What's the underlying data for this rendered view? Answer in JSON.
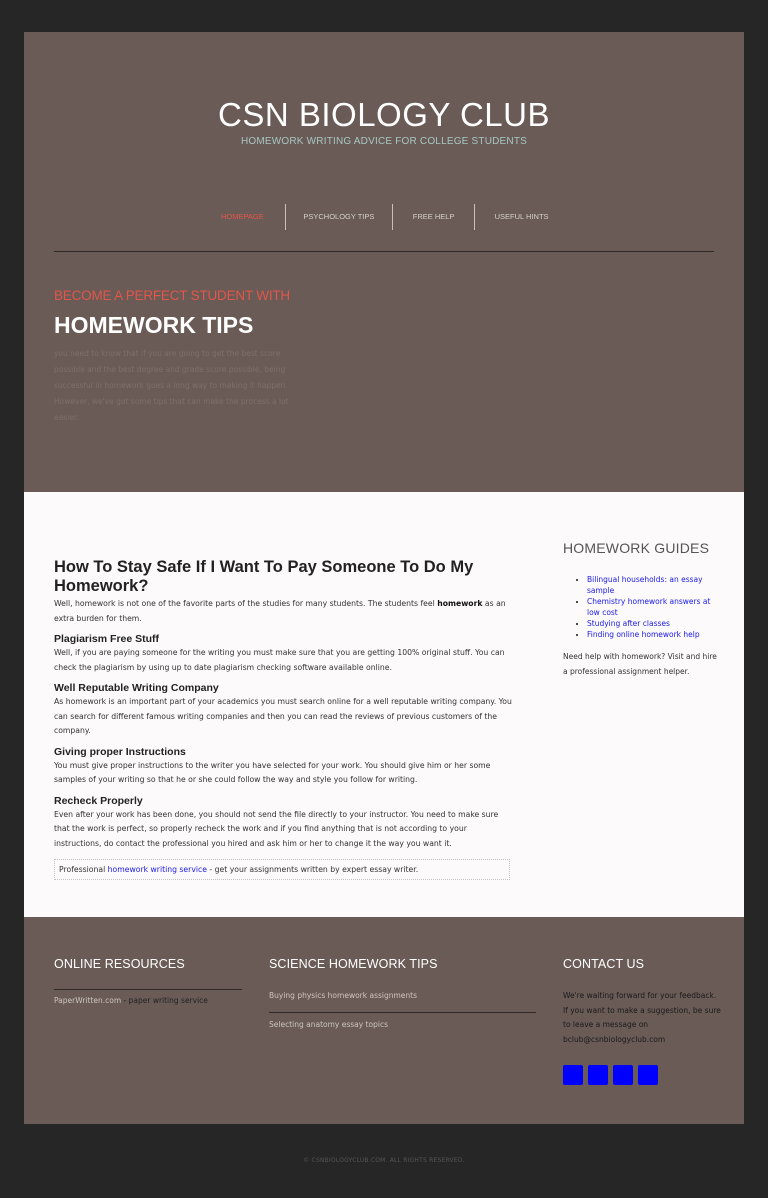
{
  "site": {
    "title": "CSN BIOLOGY CLUB",
    "tagline": "HOMEWORK WRITING ADVICE FOR COLLEGE STUDENTS"
  },
  "nav": {
    "items": [
      {
        "label": "HOMEPAGE"
      },
      {
        "label": "PSYCHOLOGY TIPS"
      },
      {
        "label": "FREE HELP"
      },
      {
        "label": "USEFUL HINTS"
      }
    ]
  },
  "hero": {
    "kicker": "BECOME A PERFECT STUDENT WITH",
    "heading": "HOMEWORK TIPS",
    "body": "you need to know that if you are going to get the best score possible and the best degree and grade score possible, being successful in homework goes a long way to making it happen. However, we've got some tips that can make the process a lot easier."
  },
  "article": {
    "title": "How To Stay Safe If I Want To Pay Someone To Do My Homework?",
    "intro_before": "Well, homework is not one of the favorite parts of the studies for many students. The students feel ",
    "intro_bold": "homework",
    "intro_after": " as an extra burden for them.",
    "sections": [
      {
        "heading": "Plagiarism Free Stuff",
        "text": "Well, if you are paying someone for the writing you must make sure that you are getting 100% original stuff. You can check the plagiarism by using up to date plagiarism checking software available online."
      },
      {
        "heading": "Well Reputable Writing Company",
        "text": "As homework is an important part of your academics you must search online for a well reputable writing company. You can search for different famous writing companies and then you can read the reviews of previous customers of the company."
      },
      {
        "heading": "Giving proper Instructions",
        "text": "You must give proper instructions to the writer you have selected for your work. You should give him or her some samples of your writing so that he or she could follow the way and style you follow for writing."
      },
      {
        "heading": "Recheck Properly",
        "text": "Even after your work has been done, you should not send the file directly to your instructor. You need to make sure that the work is perfect, so properly recheck the work and if you find anything that is not according to your instructions, do contact the professional you hired and ask him or her to change it the way you want it."
      }
    ],
    "promo_before": "Professional ",
    "promo_link": "homework writing service",
    "promo_after": " - get your assignments written by expert essay writer."
  },
  "sidebar": {
    "title": "HOMEWORK GUIDES",
    "links": [
      "Bilingual households: an essay sample",
      "Chemistry homework answers at low cost",
      "Studying after classes",
      "Finding online homework help"
    ],
    "note": "Need help with homework? Visit and hire a professional assignment helper."
  },
  "footer": {
    "resources_title": "ONLINE RESOURCES",
    "resource_link": "PaperWritten.com",
    "resource_rest": " - paper writing service",
    "tips_title": "SCIENCE HOMEWORK TIPS",
    "tips": [
      "Buying physics homework assignments",
      "Selecting anatomy essay topics"
    ],
    "contact_title": "CONTACT US",
    "contact_text": "We're waiting forward for your feedback. If you want to make a suggestion, be sure to leave a message on bclub@csnbiologyclub.com",
    "copyright": "© CSNBIOLOGYCLUB.COM. ALL RIGHTS RESERVED."
  },
  "colors": {
    "hero_bg": "#6a5b56",
    "accent": "#e2564b",
    "tagline": "#a7c7c3",
    "link": "#1a1ae6",
    "social": "#0000ff"
  }
}
